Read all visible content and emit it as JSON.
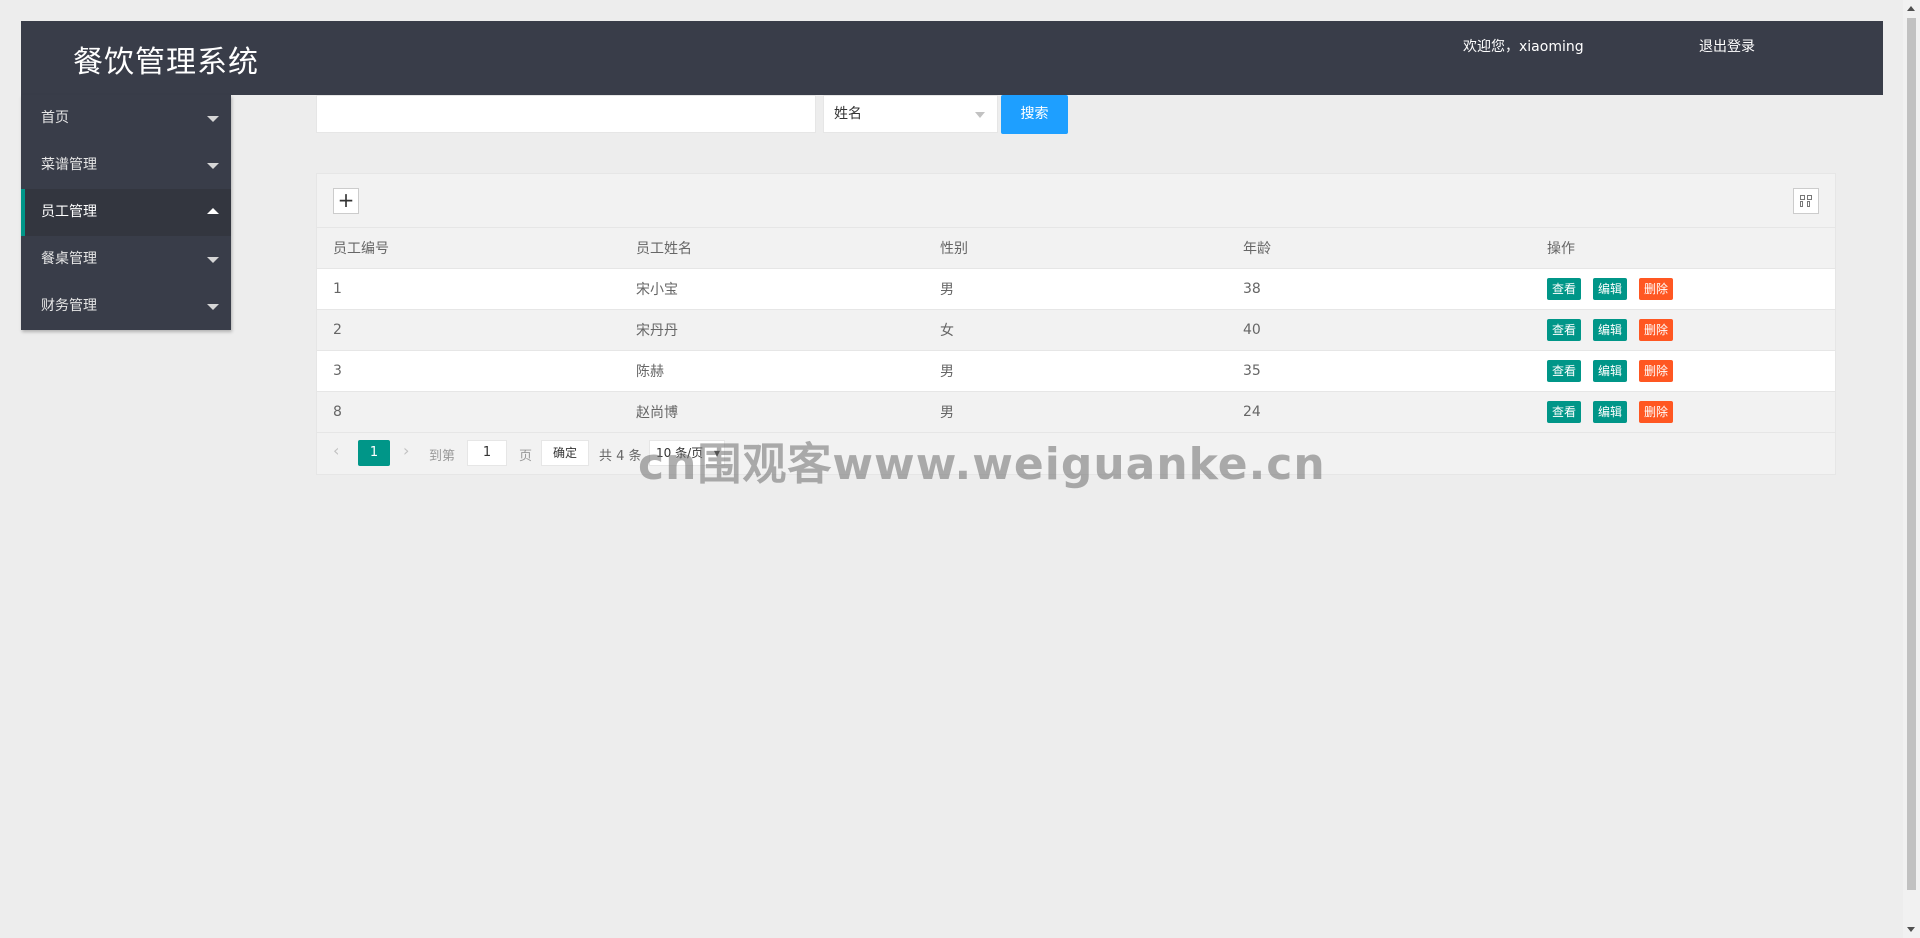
{
  "header": {
    "title": "餐饮管理系统",
    "welcome": "欢迎您，xiaoming",
    "logout": "退出登录"
  },
  "sidebar": {
    "items": [
      {
        "label": "首页",
        "expanded": false
      },
      {
        "label": "菜谱管理",
        "expanded": false
      },
      {
        "label": "员工管理",
        "expanded": true,
        "active": true
      },
      {
        "label": "餐桌管理",
        "expanded": false
      },
      {
        "label": "财务管理",
        "expanded": false
      }
    ]
  },
  "search": {
    "value": "",
    "field_selected": "姓名",
    "button": "搜索"
  },
  "toolbar": {
    "add_icon": "plus-icon",
    "columns_icon": "columns-icon"
  },
  "table": {
    "columns": [
      "员工编号",
      "员工姓名",
      "性别",
      "年龄",
      "操作"
    ],
    "rows": [
      {
        "id": "1",
        "name": "宋小宝",
        "gender": "男",
        "age": "38"
      },
      {
        "id": "2",
        "name": "宋丹丹",
        "gender": "女",
        "age": "40"
      },
      {
        "id": "3",
        "name": "陈赫",
        "gender": "男",
        "age": "35"
      },
      {
        "id": "8",
        "name": "赵尚博",
        "gender": "男",
        "age": "24"
      }
    ],
    "actions": {
      "view": "查看",
      "edit": "编辑",
      "delete": "删除"
    },
    "colors": {
      "view": "#009688",
      "edit": "#009688",
      "delete": "#ff5722"
    }
  },
  "pager": {
    "current_page": "1",
    "goto_label": "到第",
    "goto_value": "1",
    "page_label": "页",
    "confirm": "确定",
    "total": "共 4 条",
    "page_size": "10 条/页"
  },
  "watermark": "cn围观客www.weiguanke.cn",
  "colors": {
    "header_bg": "#393d49",
    "accent": "#009688",
    "search_button": "#1e9fff",
    "danger": "#ff5722"
  }
}
